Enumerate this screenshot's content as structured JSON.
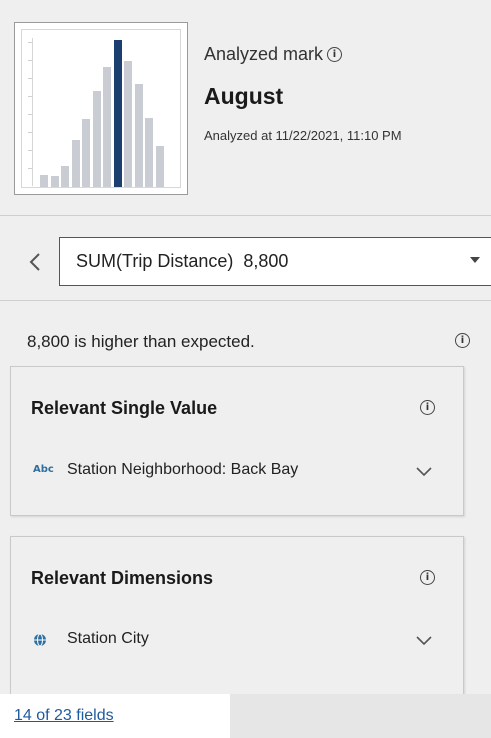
{
  "header": {
    "analyzed_label": "Analyzed mark",
    "mark_name": "August",
    "analyzed_at": "Analyzed at 11/22/2021, 11:10 PM"
  },
  "thumbnail": {
    "bar_levels": [
      0.08,
      0.07,
      0.14,
      0.31,
      0.45,
      0.64,
      0.8,
      0.98,
      0.84,
      0.69,
      0.46,
      0.27
    ],
    "selected_index": 7,
    "bar_color": "#c9cdd3",
    "selected_color": "#1b3f6e"
  },
  "measure": {
    "name": "SUM(Trip Distance)",
    "value": "8,800"
  },
  "summary": {
    "text": "8,800 is higher than expected."
  },
  "cards": {
    "single_value": {
      "title": "Relevant Single Value",
      "icon_text": "Abc",
      "item": "Station Neighborhood: Back Bay"
    },
    "dimensions": {
      "title": "Relevant Dimensions",
      "icon": "globe-icon",
      "item": "Station City"
    }
  },
  "footer": {
    "fields_link": "14 of 23 fields"
  },
  "icons": {
    "info": "i",
    "back": "‹"
  },
  "colors": {
    "link": "#1f5a9e",
    "selected_bar": "#1b3f6e"
  }
}
